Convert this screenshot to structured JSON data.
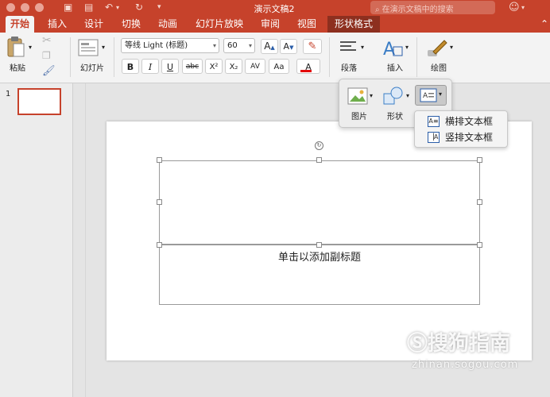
{
  "window": {
    "title": "演示文稿2",
    "search_placeholder": "在演示文稿中的搜索"
  },
  "tabs": [
    "开始",
    "插入",
    "设计",
    "切换",
    "动画",
    "幻灯片放映",
    "审阅",
    "视图",
    "形状格式"
  ],
  "ribbon": {
    "paste": "粘贴",
    "slides": "幻灯片",
    "font_name": "等线 Light (标题)",
    "font_size": "60",
    "bold": "B",
    "italic": "I",
    "underline": "U",
    "strike": "abc",
    "superscript": "X²",
    "subscript": "X₂",
    "char_spacing": "AV",
    "change_case": "Aa",
    "font_color": "A",
    "grow_font": "A",
    "shrink_font": "A",
    "paragraph": "段落",
    "insert": "插入",
    "draw": "绘图"
  },
  "insert_popup": {
    "picture": "图片",
    "shape": "形状"
  },
  "textbox_menu": {
    "horizontal": "横排文本框",
    "vertical": "竖排文本框"
  },
  "thumbnail": {
    "number": "1"
  },
  "slide": {
    "subtitle_placeholder": "单击以添加副标题"
  },
  "watermark": {
    "brand": "搜狗指南",
    "url": "zhinan.sogou.com"
  },
  "colors": {
    "accent": "#c6422b",
    "selection": "#2a5da8"
  }
}
